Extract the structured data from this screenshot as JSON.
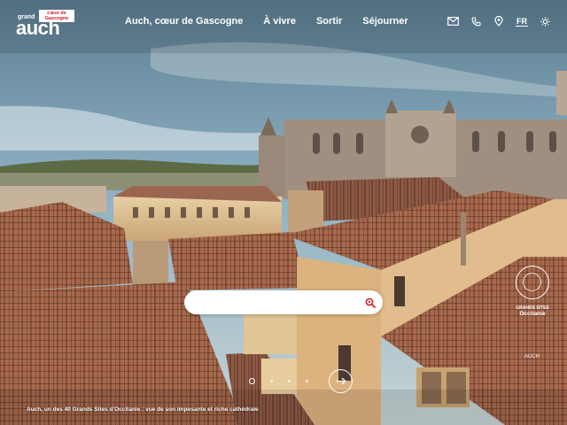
{
  "header": {
    "logo": {
      "small_text": "grand",
      "badge_text": "cœur de Gascogne",
      "word": "auch"
    },
    "nav": [
      {
        "label": "Auch, cœur de Gascogne"
      },
      {
        "label": "À vivre"
      },
      {
        "label": "Sortir"
      },
      {
        "label": "Séjourner"
      }
    ],
    "tools": {
      "icons": [
        "mail-icon",
        "phone-icon",
        "location-pin-icon",
        "sun-icon"
      ],
      "language": "FR"
    }
  },
  "search": {
    "placeholder": "",
    "value": "",
    "icon": "search-icon",
    "icon_color": "#d3212c"
  },
  "label": {
    "line1": "GRANDS SITES",
    "line2": "Occitanie"
  },
  "photo_credit": "AUCH",
  "carousel": {
    "slides": 4,
    "active_index": 0,
    "next_icon": "arrow-right-icon"
  },
  "caption": "Auch, un des 40 Grands Sites d'Occitanie : vue de son imposante et riche cathédrale",
  "colors": {
    "accent": "#d3212c",
    "text": "#ffffff"
  }
}
